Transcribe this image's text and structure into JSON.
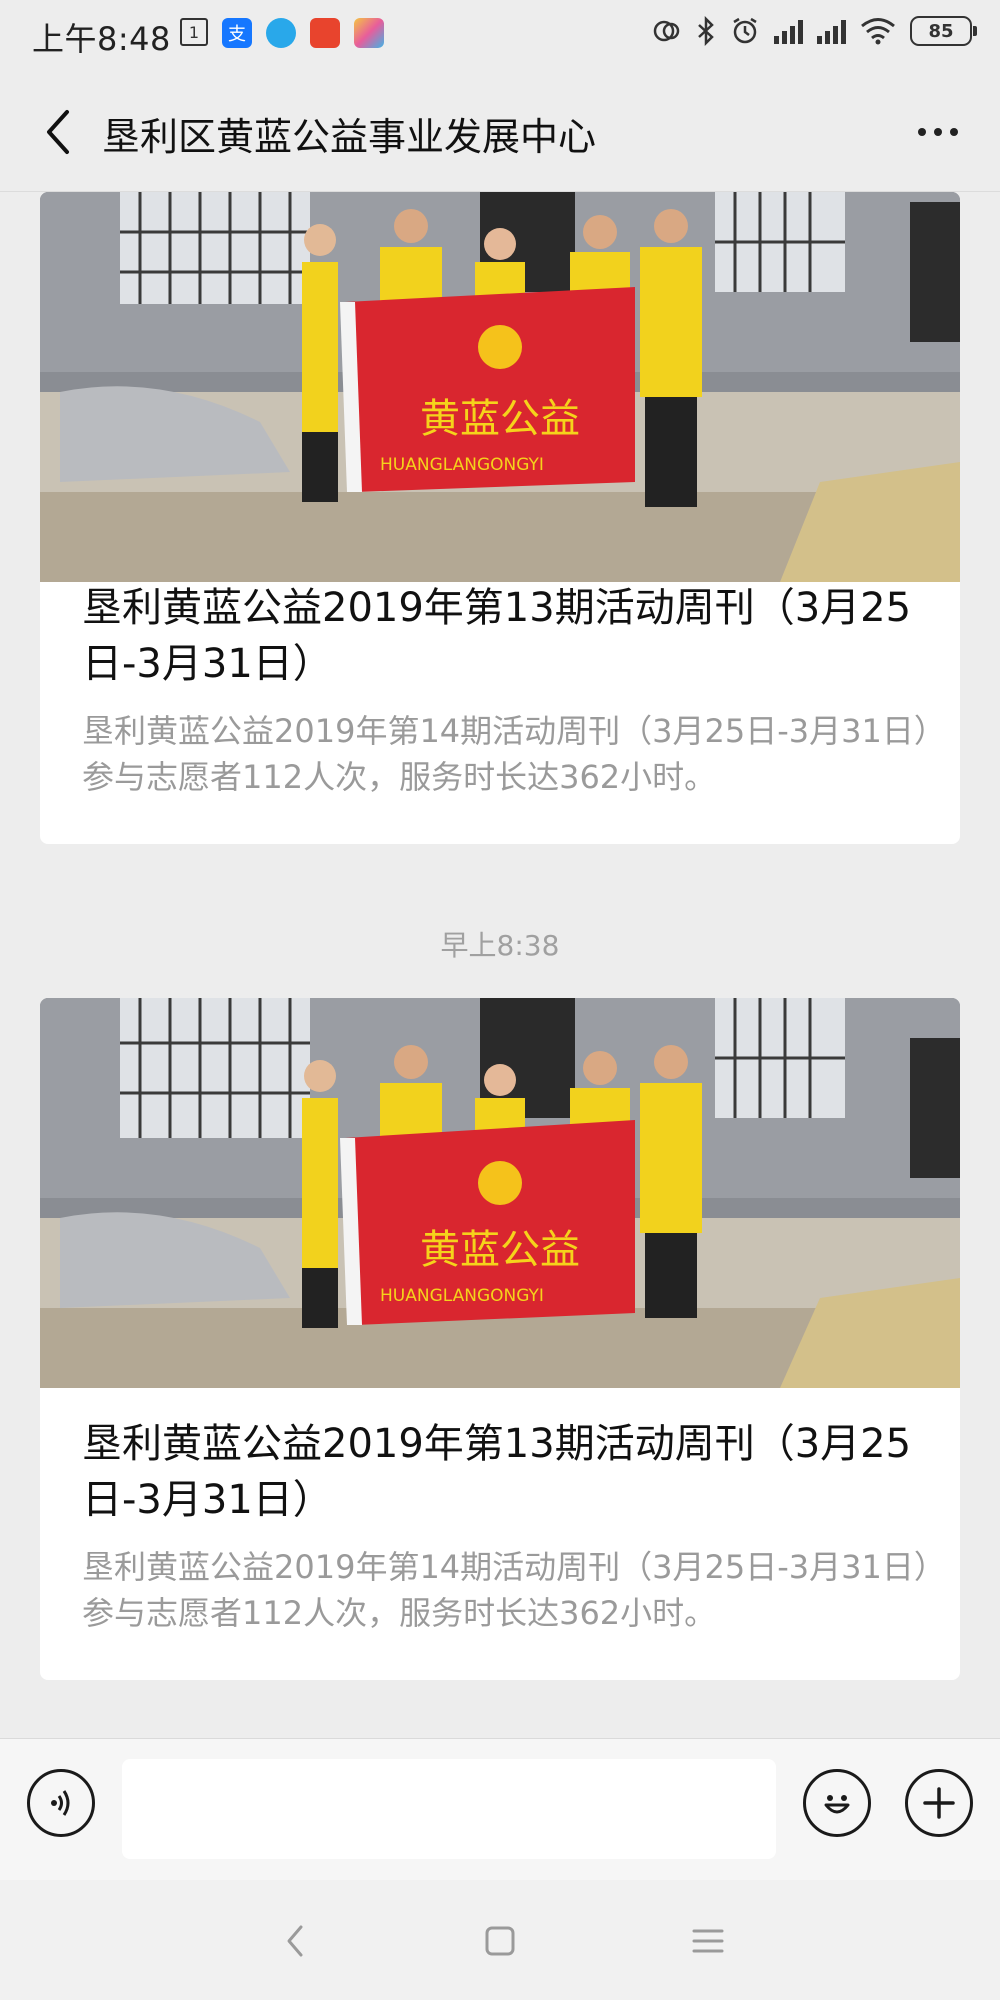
{
  "status_bar": {
    "time": "上午8:48",
    "calendar_day": "1",
    "battery": "85"
  },
  "header": {
    "title": "垦利区黄蓝公益事业发展中心"
  },
  "articles": [
    {
      "title": "垦利黄蓝公益2019年第13期活动周刊（3月25日-3月31日）",
      "description": "垦利黄蓝公益2019年第14期活动周刊（3月25日-3月31日）参与志愿者112人次，服务时长达362小时。",
      "banner_text": "黄蓝公益",
      "banner_subtext": "HUANGLANGONGYI"
    },
    {
      "title": "垦利黄蓝公益2019年第13期活动周刊（3月25日-3月31日）",
      "description": "垦利黄蓝公益2019年第14期活动周刊（3月25日-3月31日）参与志愿者112人次，服务时长达362小时。",
      "banner_text": "黄蓝公益",
      "banner_subtext": "HUANGLANGONGYI"
    }
  ],
  "timestamp": "早上8:38",
  "input_bar": {
    "placeholder": ""
  },
  "icons": {
    "back": "back-chevron-icon",
    "more": "more-dots-icon",
    "voice": "voice-icon",
    "emoji": "emoji-icon",
    "plus": "plus-icon"
  },
  "colors": {
    "background": "#ededed",
    "banner_red": "#d9262f",
    "vest_yellow": "#f2d21d"
  }
}
